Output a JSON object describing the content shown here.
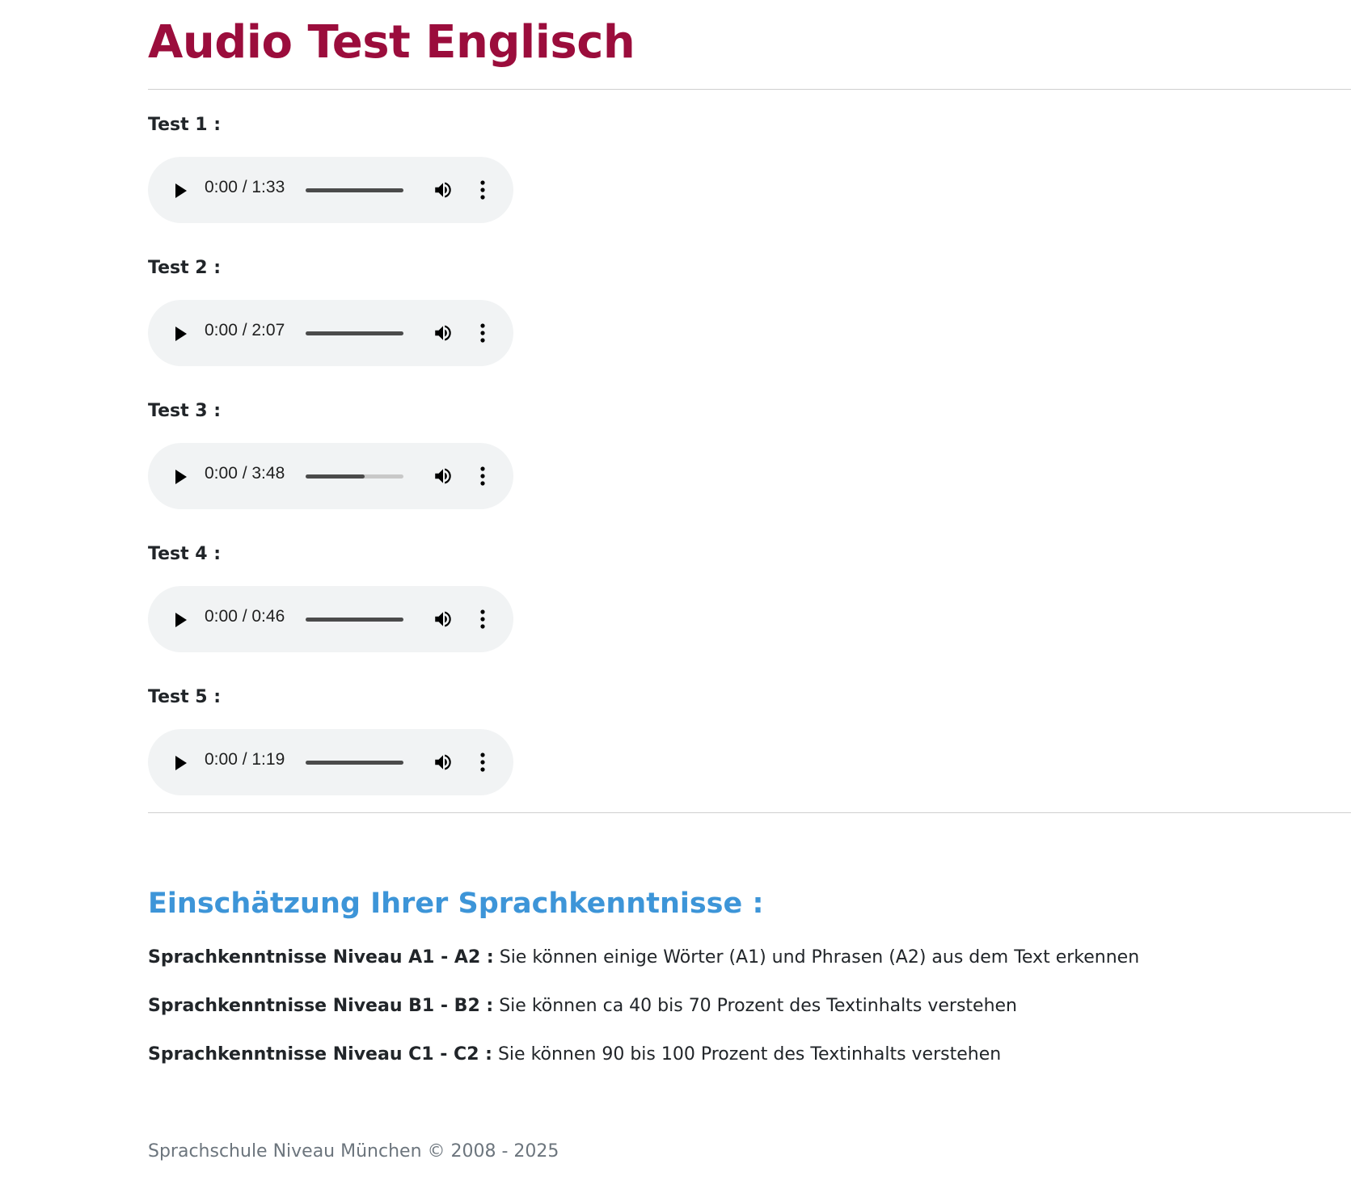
{
  "page": {
    "title": "Audio Test Englisch"
  },
  "tests": [
    {
      "label": "Test 1 :",
      "time": "0:00 / 1:33",
      "progress": 1.0
    },
    {
      "label": "Test 2 :",
      "time": "0:00 / 2:07",
      "progress": 1.0
    },
    {
      "label": "Test 3 :",
      "time": "0:00 / 3:48",
      "progress": 0.6
    },
    {
      "label": "Test 4 :",
      "time": "0:00 / 0:46",
      "progress": 1.0
    },
    {
      "label": "Test 5 :",
      "time": "0:00 / 1:19",
      "progress": 1.0
    }
  ],
  "player_icons": {
    "play": "play-icon",
    "volume": "volume-icon",
    "more": "more-vertical-icon"
  },
  "assessment": {
    "title": "Einschätzung Ihrer Sprachkenntnisse :",
    "levels": [
      {
        "name": "Sprachkenntnisse Niveau A1 - A2 :",
        "text": "Sie können einige Wörter (A1) und Phrasen (A2) aus dem Text erkennen"
      },
      {
        "name": "Sprachkenntnisse Niveau B1 - B2 :",
        "text": "Sie können ca 40 bis 70 Prozent des Textinhalts verstehen"
      },
      {
        "name": "Sprachkenntnisse Niveau C1 - C2 :",
        "text": "Sie können 90 bis 100 Prozent des Textinhalts verstehen"
      }
    ]
  },
  "footer": {
    "text": "Sprachschule Niveau München © 2008 - 2025"
  },
  "colors": {
    "title": "#9b0d3c",
    "section_title": "#3d95d8",
    "player_bg": "#f1f3f4"
  }
}
